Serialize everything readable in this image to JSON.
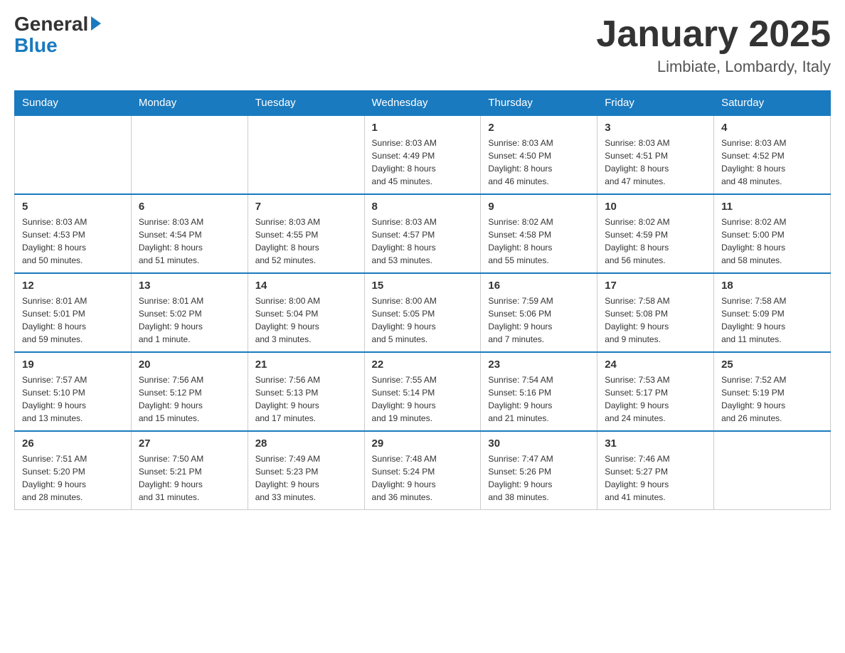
{
  "logo": {
    "general": "General",
    "blue": "Blue"
  },
  "header": {
    "month": "January 2025",
    "location": "Limbiate, Lombardy, Italy"
  },
  "days_of_week": [
    "Sunday",
    "Monday",
    "Tuesday",
    "Wednesday",
    "Thursday",
    "Friday",
    "Saturday"
  ],
  "weeks": [
    [
      {
        "day": "",
        "info": ""
      },
      {
        "day": "",
        "info": ""
      },
      {
        "day": "",
        "info": ""
      },
      {
        "day": "1",
        "info": "Sunrise: 8:03 AM\nSunset: 4:49 PM\nDaylight: 8 hours\nand 45 minutes."
      },
      {
        "day": "2",
        "info": "Sunrise: 8:03 AM\nSunset: 4:50 PM\nDaylight: 8 hours\nand 46 minutes."
      },
      {
        "day": "3",
        "info": "Sunrise: 8:03 AM\nSunset: 4:51 PM\nDaylight: 8 hours\nand 47 minutes."
      },
      {
        "day": "4",
        "info": "Sunrise: 8:03 AM\nSunset: 4:52 PM\nDaylight: 8 hours\nand 48 minutes."
      }
    ],
    [
      {
        "day": "5",
        "info": "Sunrise: 8:03 AM\nSunset: 4:53 PM\nDaylight: 8 hours\nand 50 minutes."
      },
      {
        "day": "6",
        "info": "Sunrise: 8:03 AM\nSunset: 4:54 PM\nDaylight: 8 hours\nand 51 minutes."
      },
      {
        "day": "7",
        "info": "Sunrise: 8:03 AM\nSunset: 4:55 PM\nDaylight: 8 hours\nand 52 minutes."
      },
      {
        "day": "8",
        "info": "Sunrise: 8:03 AM\nSunset: 4:57 PM\nDaylight: 8 hours\nand 53 minutes."
      },
      {
        "day": "9",
        "info": "Sunrise: 8:02 AM\nSunset: 4:58 PM\nDaylight: 8 hours\nand 55 minutes."
      },
      {
        "day": "10",
        "info": "Sunrise: 8:02 AM\nSunset: 4:59 PM\nDaylight: 8 hours\nand 56 minutes."
      },
      {
        "day": "11",
        "info": "Sunrise: 8:02 AM\nSunset: 5:00 PM\nDaylight: 8 hours\nand 58 minutes."
      }
    ],
    [
      {
        "day": "12",
        "info": "Sunrise: 8:01 AM\nSunset: 5:01 PM\nDaylight: 8 hours\nand 59 minutes."
      },
      {
        "day": "13",
        "info": "Sunrise: 8:01 AM\nSunset: 5:02 PM\nDaylight: 9 hours\nand 1 minute."
      },
      {
        "day": "14",
        "info": "Sunrise: 8:00 AM\nSunset: 5:04 PM\nDaylight: 9 hours\nand 3 minutes."
      },
      {
        "day": "15",
        "info": "Sunrise: 8:00 AM\nSunset: 5:05 PM\nDaylight: 9 hours\nand 5 minutes."
      },
      {
        "day": "16",
        "info": "Sunrise: 7:59 AM\nSunset: 5:06 PM\nDaylight: 9 hours\nand 7 minutes."
      },
      {
        "day": "17",
        "info": "Sunrise: 7:58 AM\nSunset: 5:08 PM\nDaylight: 9 hours\nand 9 minutes."
      },
      {
        "day": "18",
        "info": "Sunrise: 7:58 AM\nSunset: 5:09 PM\nDaylight: 9 hours\nand 11 minutes."
      }
    ],
    [
      {
        "day": "19",
        "info": "Sunrise: 7:57 AM\nSunset: 5:10 PM\nDaylight: 9 hours\nand 13 minutes."
      },
      {
        "day": "20",
        "info": "Sunrise: 7:56 AM\nSunset: 5:12 PM\nDaylight: 9 hours\nand 15 minutes."
      },
      {
        "day": "21",
        "info": "Sunrise: 7:56 AM\nSunset: 5:13 PM\nDaylight: 9 hours\nand 17 minutes."
      },
      {
        "day": "22",
        "info": "Sunrise: 7:55 AM\nSunset: 5:14 PM\nDaylight: 9 hours\nand 19 minutes."
      },
      {
        "day": "23",
        "info": "Sunrise: 7:54 AM\nSunset: 5:16 PM\nDaylight: 9 hours\nand 21 minutes."
      },
      {
        "day": "24",
        "info": "Sunrise: 7:53 AM\nSunset: 5:17 PM\nDaylight: 9 hours\nand 24 minutes."
      },
      {
        "day": "25",
        "info": "Sunrise: 7:52 AM\nSunset: 5:19 PM\nDaylight: 9 hours\nand 26 minutes."
      }
    ],
    [
      {
        "day": "26",
        "info": "Sunrise: 7:51 AM\nSunset: 5:20 PM\nDaylight: 9 hours\nand 28 minutes."
      },
      {
        "day": "27",
        "info": "Sunrise: 7:50 AM\nSunset: 5:21 PM\nDaylight: 9 hours\nand 31 minutes."
      },
      {
        "day": "28",
        "info": "Sunrise: 7:49 AM\nSunset: 5:23 PM\nDaylight: 9 hours\nand 33 minutes."
      },
      {
        "day": "29",
        "info": "Sunrise: 7:48 AM\nSunset: 5:24 PM\nDaylight: 9 hours\nand 36 minutes."
      },
      {
        "day": "30",
        "info": "Sunrise: 7:47 AM\nSunset: 5:26 PM\nDaylight: 9 hours\nand 38 minutes."
      },
      {
        "day": "31",
        "info": "Sunrise: 7:46 AM\nSunset: 5:27 PM\nDaylight: 9 hours\nand 41 minutes."
      },
      {
        "day": "",
        "info": ""
      }
    ]
  ]
}
